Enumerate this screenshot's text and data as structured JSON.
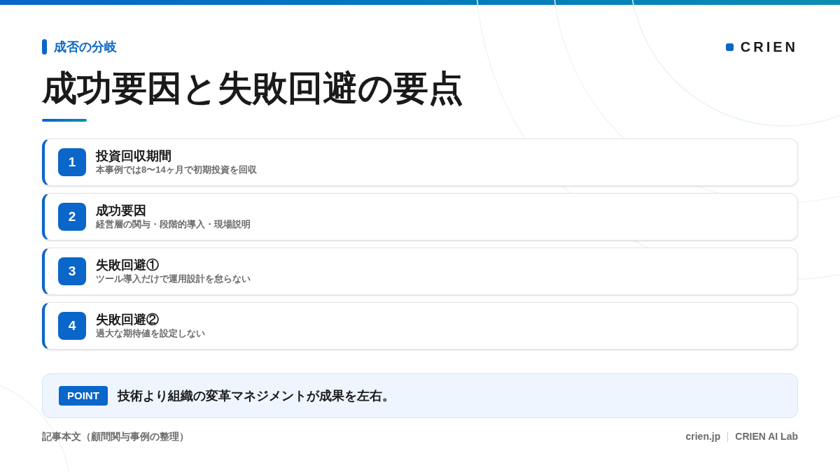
{
  "eyebrow": "成否の分岐",
  "brand": "CRIEN",
  "title": "成功要因と失敗回避の要点",
  "items": [
    {
      "number": "1",
      "title": "投資回収期間",
      "description": "本事例では8〜14ヶ月で初期投資を回収"
    },
    {
      "number": "2",
      "title": "成功要因",
      "description": "経営層の関与・段階的導入・現場説明"
    },
    {
      "number": "3",
      "title": "失敗回避①",
      "description": "ツール導入だけで運用設計を怠らない"
    },
    {
      "number": "4",
      "title": "失敗回避②",
      "description": "過大な期待値を設定しない"
    }
  ],
  "point": {
    "badge": "POINT",
    "text": "技術より組織の変革マネジメントが成果を左右。"
  },
  "footer": {
    "source": "記事本文（顧問関与事例の整理）",
    "site": "crien.jp",
    "lab": "CRIEN AI Lab"
  }
}
